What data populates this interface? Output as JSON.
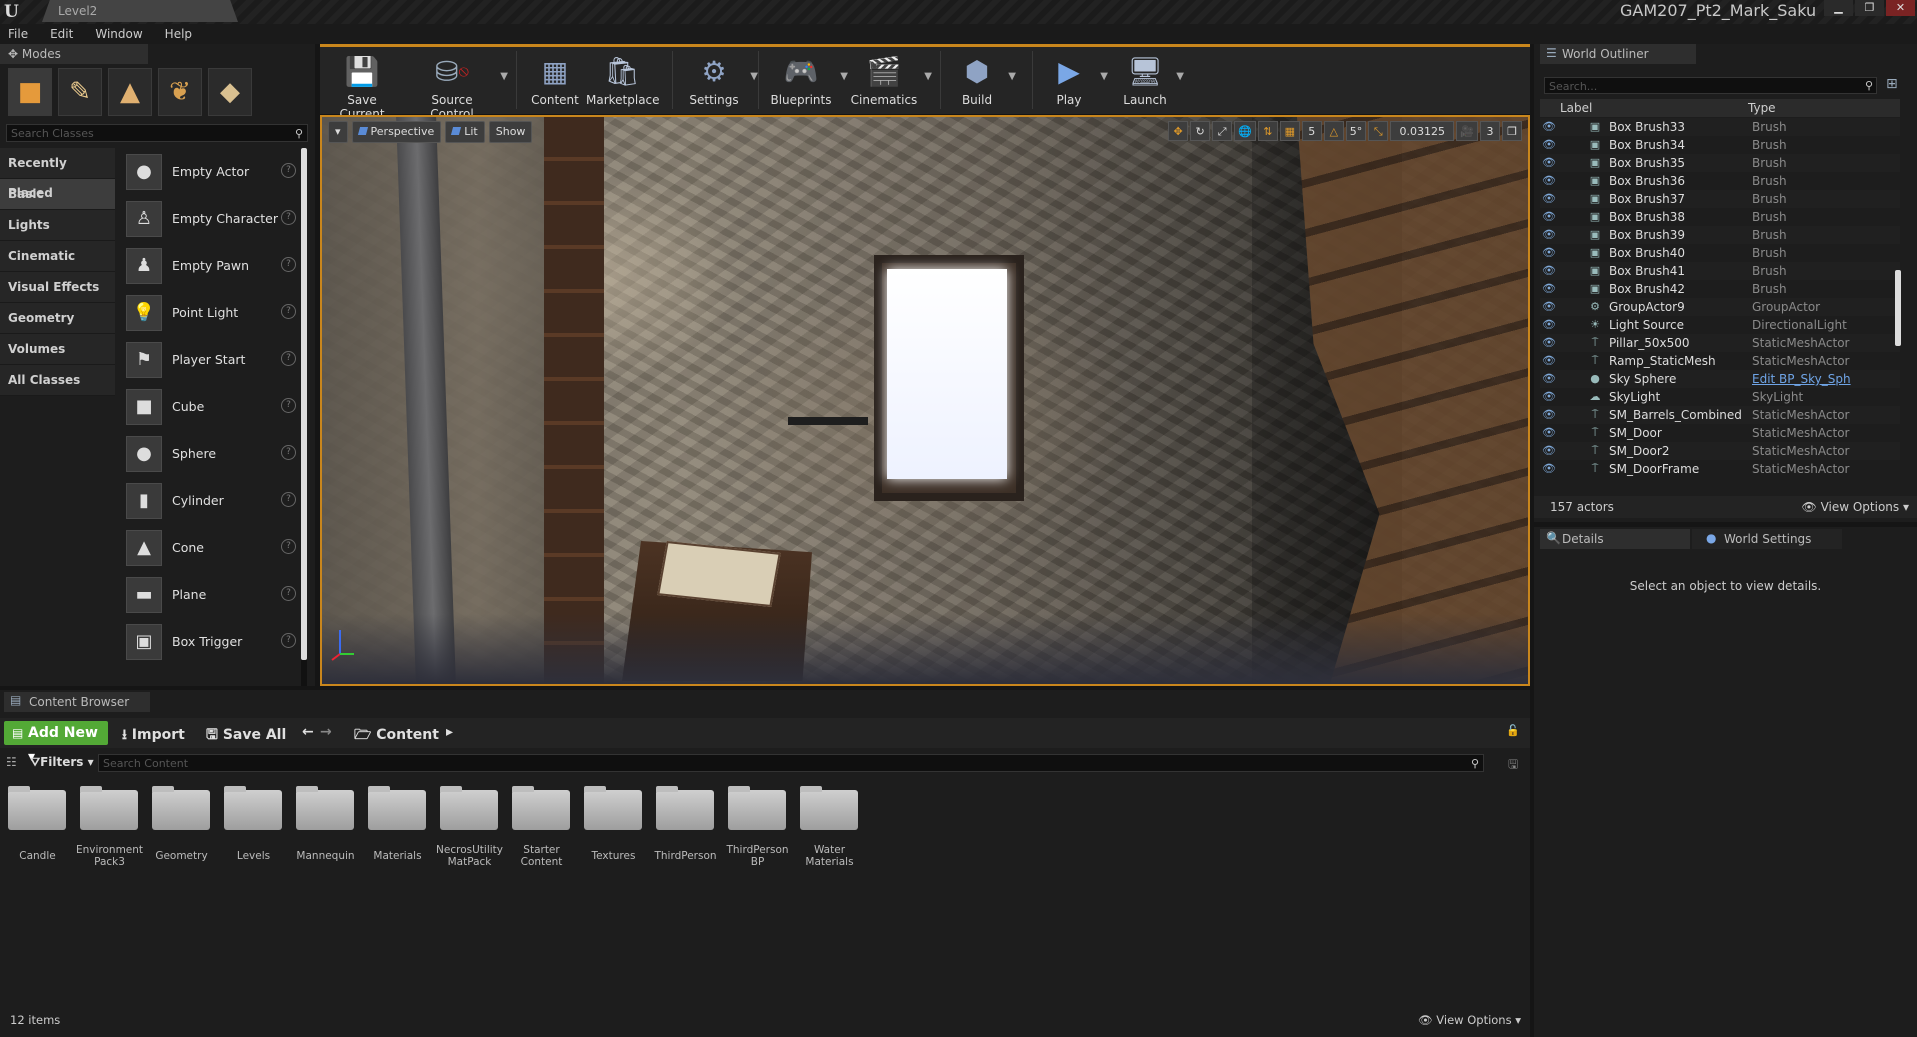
{
  "title_bar": {
    "level_tab": "Level2",
    "project_name": "GAM207_Pt2_Mark_Saku",
    "minimize": "▁",
    "maximize": "❐",
    "close": "✕"
  },
  "menu": [
    "File",
    "Edit",
    "Window",
    "Help"
  ],
  "modes": {
    "tab_label": "Modes",
    "search_placeholder": "Search Classes",
    "categories": [
      "Recently Placed",
      "Basic",
      "Lights",
      "Cinematic",
      "Visual Effects",
      "Geometry",
      "Volumes",
      "All Classes"
    ],
    "selected_category": "Basic",
    "classes": [
      "Empty Actor",
      "Empty Character",
      "Empty Pawn",
      "Point Light",
      "Player Start",
      "Cube",
      "Sphere",
      "Cylinder",
      "Cone",
      "Plane",
      "Box Trigger"
    ]
  },
  "toolbar": {
    "save_current": "Save Current",
    "source_control": "Source Control",
    "content": "Content",
    "marketplace": "Marketplace",
    "settings": "Settings",
    "blueprints": "Blueprints",
    "cinematics": "Cinematics",
    "build": "Build",
    "play": "Play",
    "launch": "Launch"
  },
  "viewport": {
    "perspective": "Perspective",
    "lit": "Lit",
    "show": "Show",
    "grid_size": "5",
    "rotation_snap": "5°",
    "scale_snap": "0.03125",
    "camera_speed": "3"
  },
  "world_outliner": {
    "tab_label": "World Outliner",
    "search_placeholder": "Search...",
    "col_label": "Label",
    "col_type": "Type",
    "rows": [
      {
        "name": "Box Brush33",
        "type": "Brush",
        "icon": "brush"
      },
      {
        "name": "Box Brush34",
        "type": "Brush",
        "icon": "brush"
      },
      {
        "name": "Box Brush35",
        "type": "Brush",
        "icon": "brush"
      },
      {
        "name": "Box Brush36",
        "type": "Brush",
        "icon": "brush"
      },
      {
        "name": "Box Brush37",
        "type": "Brush",
        "icon": "brush"
      },
      {
        "name": "Box Brush38",
        "type": "Brush",
        "icon": "brush"
      },
      {
        "name": "Box Brush39",
        "type": "Brush",
        "icon": "brush"
      },
      {
        "name": "Box Brush40",
        "type": "Brush",
        "icon": "brush"
      },
      {
        "name": "Box Brush41",
        "type": "Brush",
        "icon": "brush"
      },
      {
        "name": "Box Brush42",
        "type": "Brush",
        "icon": "brush"
      },
      {
        "name": "GroupActor9",
        "type": "GroupActor",
        "icon": "group"
      },
      {
        "name": "Light Source",
        "type": "DirectionalLight",
        "icon": "sun"
      },
      {
        "name": "Pillar_50x500",
        "type": "StaticMeshActor",
        "icon": "mesh"
      },
      {
        "name": "Ramp_StaticMesh",
        "type": "StaticMeshActor",
        "icon": "mesh"
      },
      {
        "name": "Sky Sphere",
        "type": "Edit BP_Sky_Sph",
        "icon": "sphere",
        "link": true
      },
      {
        "name": "SkyLight",
        "type": "SkyLight",
        "icon": "skylight"
      },
      {
        "name": "SM_Barrels_Combined",
        "type": "StaticMeshActor",
        "icon": "mesh"
      },
      {
        "name": "SM_Door",
        "type": "StaticMeshActor",
        "icon": "mesh"
      },
      {
        "name": "SM_Door2",
        "type": "StaticMeshActor",
        "icon": "mesh"
      },
      {
        "name": "SM_DoorFrame",
        "type": "StaticMeshActor",
        "icon": "mesh"
      }
    ],
    "actor_count": "157 actors",
    "view_options": "View Options"
  },
  "details": {
    "tab_label": "Details",
    "world_settings_tab": "World Settings",
    "empty_message": "Select an object to view details."
  },
  "content_browser": {
    "tab_label": "Content Browser",
    "add_new": "Add New",
    "import": "Import",
    "save_all": "Save All",
    "path": "Content",
    "filters": "Filters",
    "search_placeholder": "Search Content",
    "folders": [
      "Candle",
      "Environment Pack3",
      "Geometry",
      "Levels",
      "Mannequin",
      "Materials",
      "NecrosUtility MatPack",
      "Starter Content",
      "Textures",
      "ThirdPerson",
      "ThirdPerson BP",
      "Water Materials"
    ],
    "item_count": "12 items",
    "view_options": "View Options"
  },
  "colors": {
    "accent": "#c9861c",
    "add_new": "#53a936",
    "link": "#6fa4e6"
  }
}
